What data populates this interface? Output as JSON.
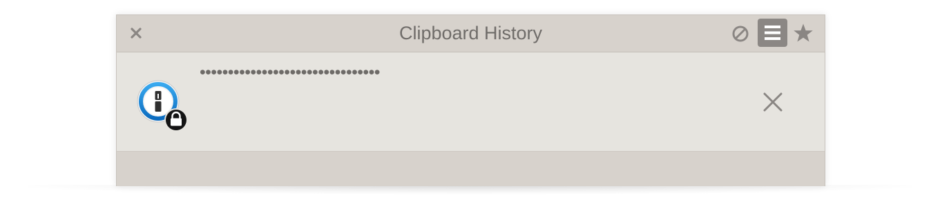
{
  "window": {
    "title": "Clipboard History"
  },
  "toolbar": {
    "close_icon": "close-icon",
    "clear_icon": "prohibit-icon",
    "menu_icon": "hamburger-menu-icon",
    "star_icon": "star-icon"
  },
  "clipboard_items": [
    {
      "app_icon": "1password-icon",
      "badge_icon": "lock-icon",
      "content": "••••••••••••••••••••••••••••••••",
      "delete_icon": "close-icon"
    }
  ],
  "colors": {
    "titlebar": "#d7d2cc",
    "content_bg": "#e6e4df",
    "text": "#6f6c69",
    "menu_button_bg": "#8b8784",
    "app_icon_blue": "#1a8ad6"
  }
}
